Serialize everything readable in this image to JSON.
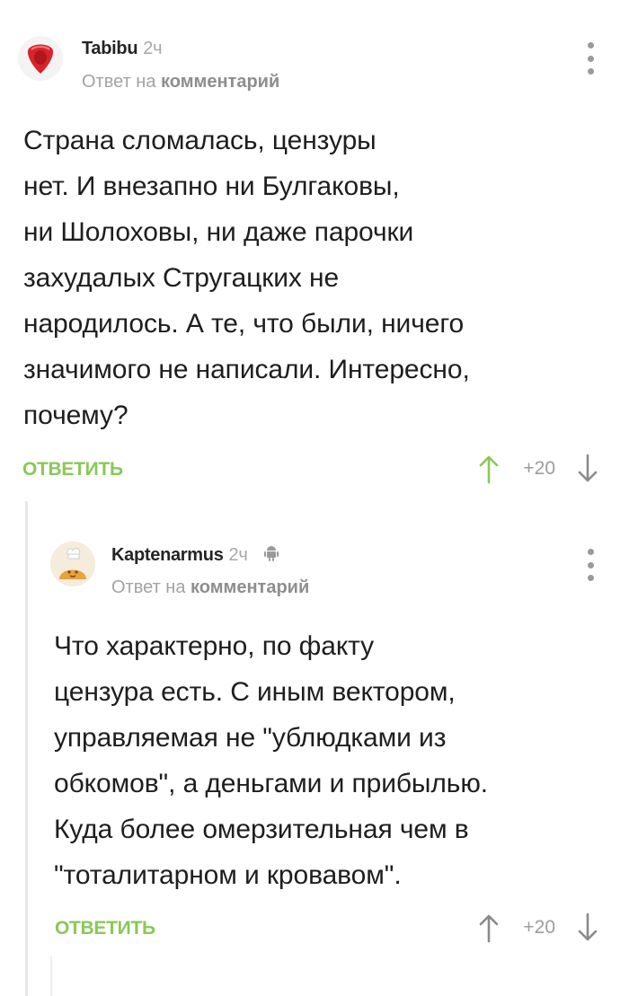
{
  "comments": [
    {
      "username": "Tabibu",
      "time": "2ч",
      "reply_prefix": "Ответ на",
      "reply_target": "комментарий",
      "text": "Страна сломалась, цензуры\nнет. И внезапно ни Булгаковы,\nни Шолоховы, ни даже парочки\nзахудалых Стругацких не\nнародилось. А те, что были, ничего\nзначимого не написали. Интересно,\nпочему?",
      "reply_button": "ОТВЕТИТЬ",
      "score": "+20"
    },
    {
      "username": "Kaptenarmus",
      "time": "2ч",
      "reply_prefix": "Ответ на",
      "reply_target": "комментарий",
      "text": "Что характерно, по факту\nцензура есть. С иным вектором,\nуправляемая не \"ублюдками из\nобкомов\", а деньгами и прибылью.\nКуда более омерзительная чем в\n\"тоталитарном и кровавом\".",
      "reply_button": "ОТВЕТИТЬ",
      "score": "+20"
    }
  ],
  "icons": {
    "avatar1": "red-guitar-pick-avatar",
    "avatar2": "bread-baker-avatar",
    "device": "android-icon",
    "menu": "more-vertical-icon",
    "upvote": "arrow-up-icon",
    "downvote": "arrow-down-icon"
  },
  "colors": {
    "accent_green": "#8ac858",
    "muted_gray": "#a3a3a3",
    "text": "#1e1e1e"
  }
}
